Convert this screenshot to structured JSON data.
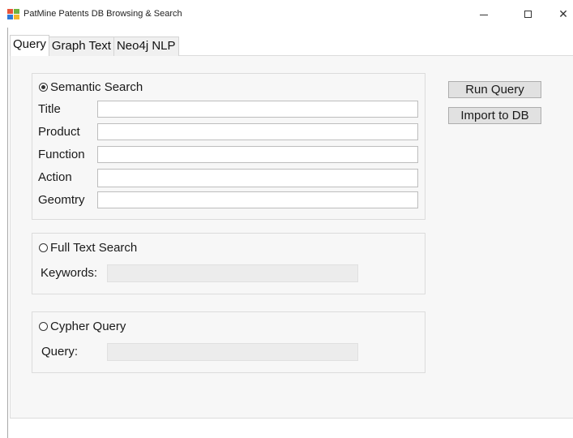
{
  "window": {
    "title": "PatMine Patents DB Browsing & Search",
    "controls": {
      "minimize": "–",
      "maximize": "☐",
      "close": "✕"
    }
  },
  "tabs": [
    {
      "label": "Query",
      "active": true
    },
    {
      "label": "Graph Text",
      "active": false
    },
    {
      "label": "Neo4j NLP",
      "active": false
    }
  ],
  "semantic": {
    "label": "Semantic Search",
    "checked": true,
    "fields": [
      {
        "label": "Title",
        "value": ""
      },
      {
        "label": "Product",
        "value": ""
      },
      {
        "label": "Function",
        "value": ""
      },
      {
        "label": "Action",
        "value": ""
      },
      {
        "label": "Geomtry",
        "value": ""
      }
    ]
  },
  "fulltext": {
    "label": "Full Text Search",
    "checked": false,
    "keywords_label": "Keywords:",
    "keywords_value": ""
  },
  "cypher": {
    "label": "Cypher Query",
    "checked": false,
    "query_label": "Query:",
    "query_value": ""
  },
  "buttons": {
    "run_query": "Run Query",
    "import_db": "Import to DB"
  }
}
